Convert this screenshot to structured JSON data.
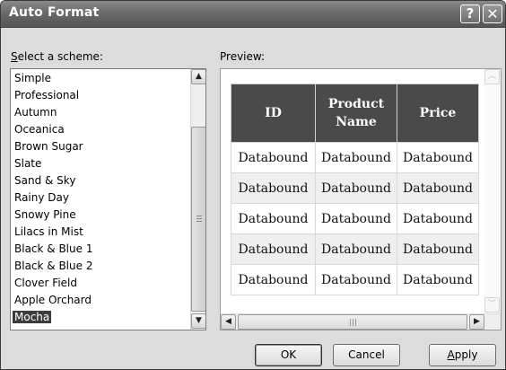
{
  "window": {
    "title": "Auto Format"
  },
  "titlebar": {
    "help_glyph": "?",
    "close_glyph": "✕"
  },
  "scheme": {
    "label_accel": "S",
    "label_rest": "elect a scheme:",
    "items": [
      "Simple",
      "Professional",
      "Autumn",
      "Oceanica",
      "Brown Sugar",
      "Slate",
      "Sand & Sky",
      "Rainy Day",
      "Snowy Pine",
      "Lilacs in Mist",
      "Black & Blue 1",
      "Black & Blue 2",
      "Clover Field",
      "Apple Orchard",
      "Mocha"
    ],
    "selected": "Mocha"
  },
  "preview": {
    "label": "Preview:",
    "columns": [
      "ID",
      "Product Name",
      "Price"
    ],
    "rows": [
      [
        "Databound",
        "Databound",
        "Databound"
      ],
      [
        "Databound",
        "Databound",
        "Databound"
      ],
      [
        "Databound",
        "Databound",
        "Databound"
      ],
      [
        "Databound",
        "Databound",
        "Databound"
      ],
      [
        "Databound",
        "Databound",
        "Databound"
      ]
    ],
    "header_color": "#4a4a4a",
    "alt_row_color": "#efefef"
  },
  "buttons": {
    "ok": "OK",
    "cancel": "Cancel",
    "apply_accel": "A",
    "apply_rest": "pply"
  }
}
